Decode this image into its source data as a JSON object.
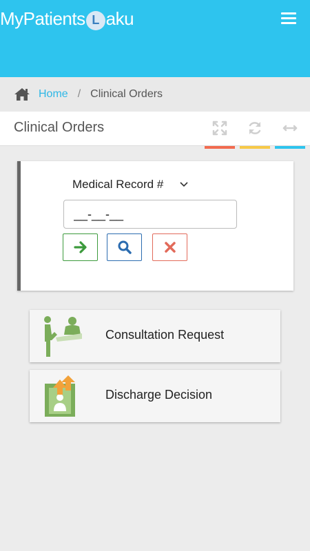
{
  "header": {
    "logo_prefix": "MyPatients",
    "logo_at": "L",
    "logo_suffix": "aku",
    "brand_color": "#2ec4ee"
  },
  "breadcrumb": {
    "home": "Home",
    "separator": "/",
    "current": "Clinical Orders"
  },
  "page": {
    "title": "Clinical Orders",
    "toolbar": [
      {
        "icon": "expand-icon",
        "color": "#f26b4f"
      },
      {
        "icon": "refresh-icon",
        "color": "#f7c948"
      },
      {
        "icon": "horizontal-arrows-icon",
        "color": "#2ec4ee"
      }
    ]
  },
  "search": {
    "field_type": "Medical Record #",
    "input_value": "__-__-__",
    "buttons": [
      {
        "icon": "arrow-right-icon",
        "color": "#3c9a3c"
      },
      {
        "icon": "search-icon",
        "color": "#2b6cb0"
      },
      {
        "icon": "close-icon",
        "color": "#e26a5a"
      }
    ]
  },
  "tiles": [
    {
      "label": "Consultation Request",
      "icon": "consultation-icon"
    },
    {
      "label": "Discharge Decision",
      "icon": "discharge-icon"
    }
  ]
}
